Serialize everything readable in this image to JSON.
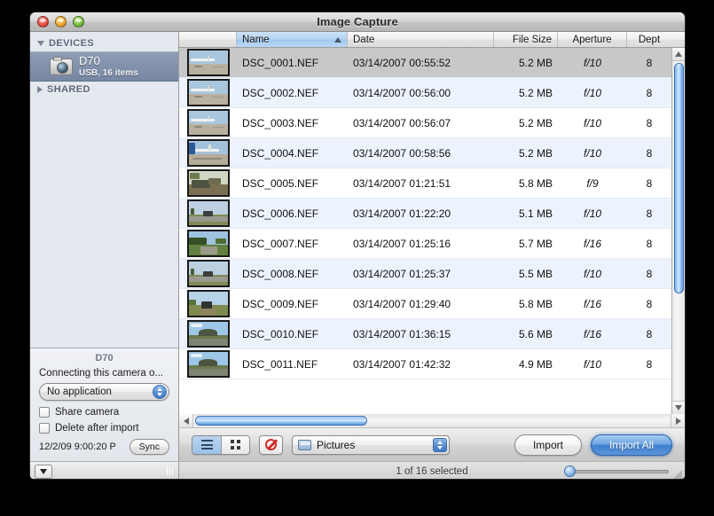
{
  "window": {
    "title": "Image Capture",
    "controls": {
      "close": "close",
      "minimize": "minimize",
      "zoom": "zoom"
    }
  },
  "sidebar": {
    "groups": [
      {
        "label": "DEVICES",
        "expanded": true
      },
      {
        "label": "SHARED",
        "expanded": false
      }
    ],
    "device": {
      "name": "D70",
      "subtitle": "USB, 16 items",
      "icon": "camera-icon",
      "selected": true
    },
    "info": {
      "title": "D70",
      "connect_label": "Connecting this camera o...",
      "app_popup_value": "No application",
      "checkboxes": [
        {
          "label": "Share camera",
          "checked": false
        },
        {
          "label": "Delete after import",
          "checked": false
        }
      ],
      "sync_date": "12/2/09 9:00:20 P",
      "sync_button": "Sync"
    },
    "bottom": {
      "action_icon": "action-triangle-icon",
      "grip": "resize-grip"
    }
  },
  "table": {
    "columns": [
      {
        "key": "thumb",
        "label": "",
        "sorted": false
      },
      {
        "key": "name",
        "label": "Name",
        "sorted": true,
        "direction": "ascending"
      },
      {
        "key": "date",
        "label": "Date",
        "sorted": false
      },
      {
        "key": "size",
        "label": "File Size",
        "sorted": false
      },
      {
        "key": "aper",
        "label": "Aperture",
        "sorted": false
      },
      {
        "key": "depth",
        "label": "Dept",
        "sorted": false
      }
    ],
    "rows": [
      {
        "name": "DSC_0001.NEF",
        "date": "03/14/2007 00:55:52",
        "size": "5.2 MB",
        "aperture": "f/10",
        "depth": "8",
        "selected": true,
        "thumb": "airport-plane"
      },
      {
        "name": "DSC_0002.NEF",
        "date": "03/14/2007 00:56:00",
        "size": "5.2 MB",
        "aperture": "f/10",
        "depth": "8",
        "selected": false,
        "thumb": "airport-plane"
      },
      {
        "name": "DSC_0003.NEF",
        "date": "03/14/2007 00:56:07",
        "size": "5.2 MB",
        "aperture": "f/10",
        "depth": "8",
        "selected": false,
        "thumb": "airport-plane"
      },
      {
        "name": "DSC_0004.NEF",
        "date": "03/14/2007 00:58:56",
        "size": "5.2 MB",
        "aperture": "f/10",
        "depth": "8",
        "selected": false,
        "thumb": "airport-tail"
      },
      {
        "name": "DSC_0005.NEF",
        "date": "03/14/2007 01:21:51",
        "size": "5.8 MB",
        "aperture": "f/9",
        "depth": "8",
        "selected": false,
        "thumb": "vehicle-field"
      },
      {
        "name": "DSC_0006.NEF",
        "date": "03/14/2007 01:22:20",
        "size": "5.1 MB",
        "aperture": "f/10",
        "depth": "8",
        "selected": false,
        "thumb": "road-vehicle"
      },
      {
        "name": "DSC_0007.NEF",
        "date": "03/14/2007 01:25:16",
        "size": "5.7 MB",
        "aperture": "f/16",
        "depth": "8",
        "selected": false,
        "thumb": "green-road"
      },
      {
        "name": "DSC_0008.NEF",
        "date": "03/14/2007 01:25:37",
        "size": "5.5 MB",
        "aperture": "f/10",
        "depth": "8",
        "selected": false,
        "thumb": "road-vehicle"
      },
      {
        "name": "DSC_0009.NEF",
        "date": "03/14/2007 01:29:40",
        "size": "5.8 MB",
        "aperture": "f/16",
        "depth": "8",
        "selected": false,
        "thumb": "dirt-road"
      },
      {
        "name": "DSC_0010.NEF",
        "date": "03/14/2007 01:36:15",
        "size": "5.6 MB",
        "aperture": "f/16",
        "depth": "8",
        "selected": false,
        "thumb": "hill-landscape"
      },
      {
        "name": "DSC_0011.NEF",
        "date": "03/14/2007 01:42:32",
        "size": "4.9 MB",
        "aperture": "f/10",
        "depth": "8",
        "selected": false,
        "thumb": "hill-landscape"
      }
    ]
  },
  "scrollbars": {
    "vertical": {
      "thumb_size_pct": 68,
      "thumb_pos_pct": 0
    },
    "horizontal": {
      "thumb_size_pct": 36,
      "thumb_pos_pct": 0
    }
  },
  "toolbar": {
    "view_list_icon": "list-view-icon",
    "view_grid_icon": "grid-view-icon",
    "view_active": "list",
    "delete_icon": "no-entry-icon",
    "destination_popup": {
      "value": "Pictures",
      "icon": "folder-icon"
    },
    "import_label": "Import",
    "import_all_label": "Import All"
  },
  "statusbar": {
    "text": "1 of 16 selected",
    "slider": {
      "value_pct": 0
    }
  },
  "colors": {
    "accent_blue": "#3f7fcf",
    "selected_row": "#c8c8c8",
    "alt_row": "#edf3fd",
    "sidebar_bg": "#e4e8ef",
    "sidebar_selection": "#77879f"
  }
}
